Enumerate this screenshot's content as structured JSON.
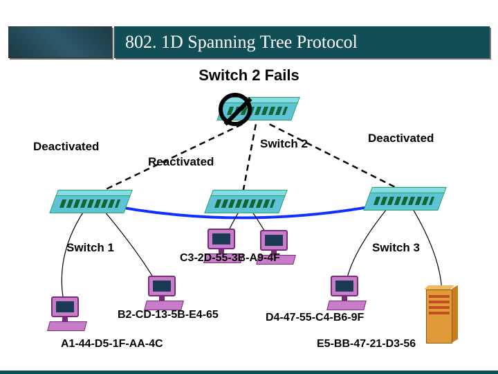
{
  "slide": {
    "title": "802. 1D Spanning Tree Protocol",
    "subtitle": "Switch 2 Fails"
  },
  "labels": {
    "deactivated_left": "Deactivated",
    "deactivated_right": "Deactivated",
    "reactivated": "Reactivated",
    "switch1": "Switch 1",
    "switch2": "Switch 2",
    "switch3": "Switch 3"
  },
  "mac": {
    "center": "C3-2D-55-3B-A9-4F",
    "left_inner": "B2-CD-13-5B-E4-65",
    "left_outer": "A1-44-D5-1F-AA-4C",
    "right_inner": "D4-47-55-C4-B6-9F",
    "right_outer": "E5-BB-47-21-D3-56"
  }
}
